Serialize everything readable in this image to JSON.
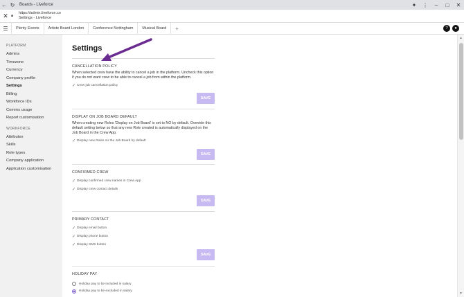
{
  "browser": {
    "tab_title": "Boards - Liveforce",
    "url": "https://admin.liveforce.co",
    "page_title": "Settings - Liveforce"
  },
  "tabs": [
    {
      "label": "Plenty Events"
    },
    {
      "label": "Artiste Board London"
    },
    {
      "label": "Conference Nottingham"
    },
    {
      "label": "Musical Board"
    },
    {
      "label": "+"
    }
  ],
  "header_icons": {
    "help": "?",
    "user": "●"
  },
  "sidebar": {
    "platform_label": "PLATFORM",
    "platform_items": [
      {
        "label": "Admins"
      },
      {
        "label": "Timezone"
      },
      {
        "label": "Currency"
      },
      {
        "label": "Company profile"
      },
      {
        "label": "Settings",
        "active": true
      },
      {
        "label": "Billing"
      },
      {
        "label": "Workforce IDs"
      },
      {
        "label": "Comms usage"
      },
      {
        "label": "Report customisation"
      }
    ],
    "workforce_label": "WORKFORCE",
    "workforce_items": [
      {
        "label": "Attributes"
      },
      {
        "label": "Skills"
      },
      {
        "label": "Role types"
      },
      {
        "label": "Company application"
      },
      {
        "label": "Application customisation"
      }
    ]
  },
  "main": {
    "title": "Settings",
    "save_label": "SAVE",
    "cancellation": {
      "title": "CANCELLATION POLICY",
      "desc": "When selected crew have the ability to cancel a job in the platform. Uncheck this option if you do not want crew to be able to cancel a job from within the platform.",
      "checks": [
        {
          "label": "Crew job cancellation policy"
        }
      ]
    },
    "job_board": {
      "title": "DISPLAY ON JOB BOARD DEFAULT",
      "desc": "When creating new Roles 'Display on Job Board' is set to NO by default. Override this default setting below so that any new Role created is automatically displayed on the Job Board in the Crew App.",
      "checks": [
        {
          "label": "Display new Roles on the Job Board by default"
        }
      ]
    },
    "confirmed_crew": {
      "title": "CONFIRMED CREW",
      "checks": [
        {
          "label": "Display confirmed crew names in Crew App"
        },
        {
          "label": "Display crew contact details"
        }
      ]
    },
    "primary_contact": {
      "title": "PRIMARY CONTACT",
      "checks": [
        {
          "label": "Display email button"
        },
        {
          "label": "Display phone button"
        },
        {
          "label": "Display SMS button"
        }
      ]
    },
    "holiday_pay": {
      "title": "HOLIDAY PAY",
      "options": [
        {
          "label": "Holiday pay to be included in salary",
          "selected": false
        },
        {
          "label": "Holiday pay to be excluded in salary",
          "selected": true
        }
      ]
    }
  },
  "colors": {
    "accent": "#7a5ccf",
    "save_button": "#c7b9f2",
    "annotation_arrow": "#6b2c91"
  }
}
